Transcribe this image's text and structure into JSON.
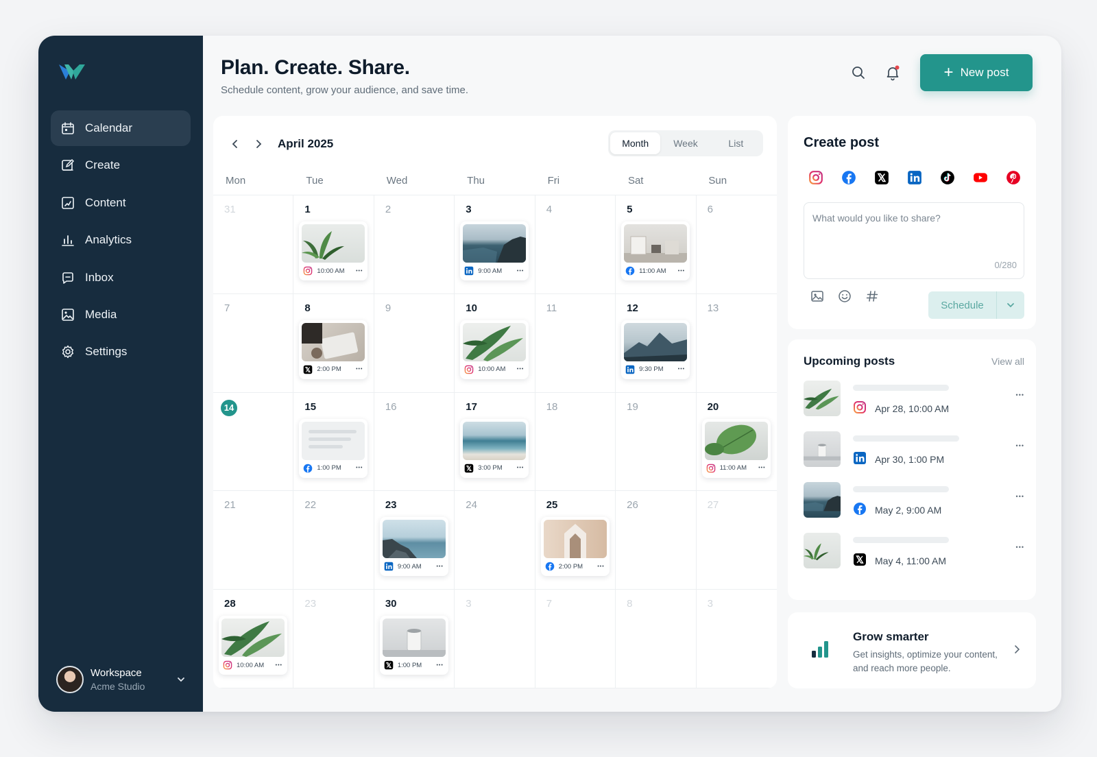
{
  "brand": {
    "logo": "brand-logo"
  },
  "sidebar": {
    "items": [
      {
        "label": "Calendar",
        "icon": "calendar-icon",
        "active": true
      },
      {
        "label": "Create",
        "icon": "edit-icon"
      },
      {
        "label": "Content",
        "icon": "content-icon"
      },
      {
        "label": "Analytics",
        "icon": "analytics-icon"
      },
      {
        "label": "Inbox",
        "icon": "inbox-icon"
      },
      {
        "label": "Media",
        "icon": "media-icon"
      },
      {
        "label": "Settings",
        "icon": "gear-icon"
      }
    ],
    "workspace": {
      "name": "Workspace",
      "org": "Acme Studio"
    }
  },
  "header": {
    "title": "Plan. Create. Share.",
    "subtitle": "Schedule content, grow your audience, and save time.",
    "new_post_label": "New post",
    "notification_dot": "#e5484d"
  },
  "calendar": {
    "month": "April 2025",
    "views": [
      "Month",
      "Week",
      "List"
    ],
    "active_view": "Month",
    "weekdays": [
      "Mon",
      "Tue",
      "Wed",
      "Thu",
      "Fri",
      "Sat",
      "Sun"
    ],
    "cells": [
      {
        "d": "31",
        "s": "faded"
      },
      {
        "d": "1",
        "post": {
          "net": "instagram",
          "time": "10:00 AM",
          "img": "plant"
        }
      },
      {
        "d": "2",
        "s": "muted"
      },
      {
        "d": "3",
        "post": {
          "net": "linkedin",
          "time": "9:00 AM",
          "img": "coast"
        }
      },
      {
        "d": "4",
        "s": "muted"
      },
      {
        "d": "5",
        "post": {
          "net": "facebook",
          "time": "11:00 AM",
          "img": "room"
        }
      },
      {
        "d": "6",
        "s": "muted"
      },
      {
        "d": "7",
        "s": "muted"
      },
      {
        "d": "8",
        "post": {
          "net": "x",
          "time": "2:00 PM",
          "img": "desk"
        }
      },
      {
        "d": "9",
        "s": "muted"
      },
      {
        "d": "10",
        "post": {
          "net": "instagram",
          "time": "10:00 AM",
          "img": "leaf"
        }
      },
      {
        "d": "11",
        "s": "muted"
      },
      {
        "d": "12",
        "post": {
          "net": "linkedin",
          "time": "9:30 PM",
          "img": "mountain"
        }
      },
      {
        "d": "13",
        "s": "muted"
      },
      {
        "d": "14",
        "s": "today"
      },
      {
        "d": "15",
        "post": {
          "net": "facebook",
          "time": "1:00 PM",
          "img": "text"
        }
      },
      {
        "d": "16",
        "s": "muted"
      },
      {
        "d": "17",
        "post": {
          "net": "x",
          "time": "3:00 PM",
          "img": "beach"
        }
      },
      {
        "d": "18",
        "s": "muted"
      },
      {
        "d": "19",
        "s": "muted"
      },
      {
        "d": "20",
        "post": {
          "net": "instagram",
          "time": "11:00 AM",
          "img": "leaf2"
        }
      },
      {
        "d": "21",
        "s": "muted"
      },
      {
        "d": "22",
        "s": "muted"
      },
      {
        "d": "23",
        "post": {
          "net": "linkedin",
          "time": "9:00 AM",
          "img": "coast2"
        }
      },
      {
        "d": "24",
        "s": "muted"
      },
      {
        "d": "25",
        "post": {
          "net": "facebook",
          "time": "2:00 PM",
          "img": "arch"
        }
      },
      {
        "d": "26",
        "s": "muted"
      },
      {
        "d": "27",
        "s": "faded"
      },
      {
        "d": "28",
        "post": {
          "net": "instagram",
          "time": "10:00 AM",
          "img": "leaf"
        }
      },
      {
        "d": "23",
        "s": "faded"
      },
      {
        "d": "30",
        "post": {
          "net": "x",
          "time": "1:00 PM",
          "img": "cup"
        }
      },
      {
        "d": "3",
        "s": "faded"
      },
      {
        "d": "7",
        "s": "faded"
      },
      {
        "d": "8",
        "s": "faded"
      },
      {
        "d": "3",
        "s": "faded"
      }
    ]
  },
  "create_post": {
    "title": "Create post",
    "networks": [
      "instagram",
      "facebook",
      "x",
      "linkedin",
      "tiktok",
      "youtube",
      "pinterest"
    ],
    "placeholder": "What would you like to share?",
    "counter": "0/280",
    "tools": [
      "image-icon",
      "emoji-icon",
      "hashtag-icon"
    ],
    "schedule_label": "Schedule"
  },
  "upcoming": {
    "title": "Upcoming posts",
    "view_all": "View all",
    "items": [
      {
        "net": "instagram",
        "date": "Apr 28, 10:00 AM",
        "img": "leaf"
      },
      {
        "net": "linkedin",
        "date": "Apr 30, 1:00 PM",
        "img": "cup"
      },
      {
        "net": "facebook",
        "date": "May 2, 9:00 AM",
        "img": "coast"
      },
      {
        "net": "x",
        "date": "May 4, 11:00 AM",
        "img": "plant"
      }
    ]
  },
  "grow": {
    "title": "Grow smarter",
    "description": "Get insights, optimize your content, and reach more people."
  },
  "colors": {
    "accent": "#23958c",
    "sidebar": "#172c3e",
    "instagram": "#e1306c",
    "facebook": "#1877f2",
    "linkedin": "#0a66c2",
    "x": "#000000",
    "youtube": "#ff0000",
    "pinterest": "#e60023",
    "tiktok": "#000000"
  }
}
